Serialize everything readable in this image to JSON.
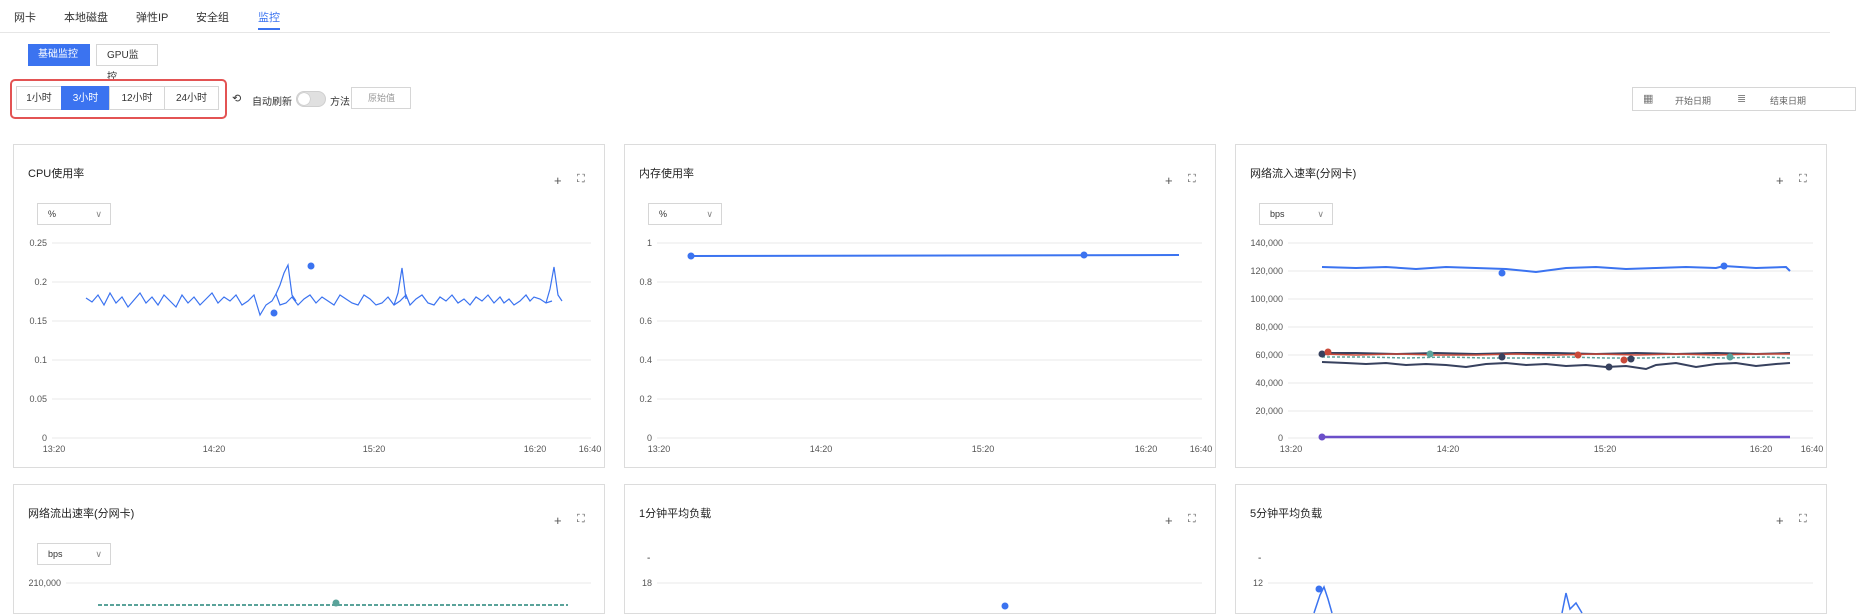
{
  "tabs": [
    "网卡",
    "本地磁盘",
    "弹性IP",
    "安全组",
    "监控"
  ],
  "subtabs": {
    "basic": "基础监控",
    "gpu": "GPU监控"
  },
  "ranges": [
    "1小时",
    "3小时",
    "12小时",
    "24小时"
  ],
  "active_range": "3小时",
  "auto_refresh_label": "自动刷新",
  "refresh_icon": "refresh-icon",
  "method_label": "方法",
  "method_placeholder": "原始值",
  "date": {
    "start": "开始日期",
    "end": "结束日期",
    "icon": "calendar-icon"
  },
  "colors": {
    "accent": "#3b73f0",
    "highlight": "#e35353"
  },
  "panels": [
    {
      "title": "CPU使用率",
      "unit": "%"
    },
    {
      "title": "内存使用率",
      "unit": "%"
    },
    {
      "title": "网络流入速率(分网卡)",
      "unit": "bps"
    },
    {
      "title": "网络流出速率(分网卡)",
      "unit": "bps"
    },
    {
      "title": "1分钟平均负载",
      "unit": "-"
    },
    {
      "title": "5分钟平均负载",
      "unit": "-"
    }
  ],
  "chart_data": [
    {
      "type": "line",
      "xticks": [
        "13:20",
        "14:20",
        "15:20",
        "16:20",
        "16:40"
      ],
      "yticks": [
        "0.25",
        "0.2",
        "0.15",
        "0.1",
        "0.05",
        "0"
      ],
      "ylim": [
        0,
        0.25
      ],
      "series": [
        {
          "avg": 0.178,
          "min": 0.158,
          "max": 0.222
        }
      ]
    },
    {
      "type": "line",
      "xticks": [
        "13:20",
        "14:20",
        "15:20",
        "16:20",
        "16:40"
      ],
      "yticks": [
        "1",
        "0.8",
        "0.6",
        "0.4",
        "0.2",
        "0"
      ],
      "ylim": [
        0,
        1
      ],
      "series": [
        {
          "avg": 0.935
        }
      ]
    },
    {
      "type": "line",
      "xticks": [
        "13:20",
        "14:20",
        "15:20",
        "16:20",
        "16:40"
      ],
      "yticks": [
        "140,000",
        "120,000",
        "100,000",
        "80,000",
        "60,000",
        "40,000",
        "20,000",
        "0"
      ],
      "ylim": [
        0,
        140000
      ],
      "series": [
        {
          "avg": 123000
        },
        {
          "avg": 61000
        },
        {
          "avg": 59000
        },
        {
          "avg": 55000
        },
        {
          "avg": 0
        }
      ]
    },
    {
      "type": "line",
      "yticks": [
        "210,000"
      ]
    },
    {
      "type": "line",
      "yticks": [
        "18"
      ]
    },
    {
      "type": "line",
      "yticks": [
        "12"
      ]
    }
  ]
}
